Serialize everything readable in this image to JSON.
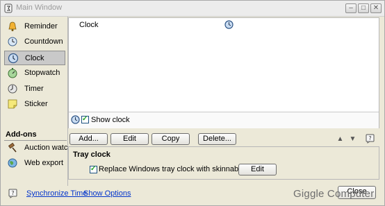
{
  "window": {
    "title": "Main Window"
  },
  "sidebar": {
    "items": [
      {
        "label": "Reminder",
        "icon": "bell-icon"
      },
      {
        "label": "Countdown",
        "icon": "countdown-icon"
      },
      {
        "label": "Clock",
        "icon": "clock-icon",
        "selected": true
      },
      {
        "label": "Stopwatch",
        "icon": "stopwatch-icon"
      },
      {
        "label": "Timer",
        "icon": "timer-icon"
      },
      {
        "label": "Sticker",
        "icon": "sticker-icon"
      }
    ],
    "addons_heading": "Add-ons",
    "addons": [
      {
        "label": "Auction watch",
        "icon": "auction-icon"
      },
      {
        "label": "Web export",
        "icon": "globe-icon"
      }
    ]
  },
  "main": {
    "list_item": "Clock",
    "show_clock_label": "Show clock",
    "buttons": {
      "add": "Add...",
      "edit": "Edit",
      "copy": "Copy",
      "delete": "Delete..."
    },
    "tray": {
      "heading": "Tray clock",
      "replace_label": "Replace Windows tray clock with skinnable clock",
      "edit": "Edit"
    }
  },
  "footer": {
    "sync_label": "Synchronize Time",
    "options_label": "Show Options",
    "close_label": "Close",
    "watermark": "Giggle Computer"
  },
  "colors": {
    "link": "#0033cc",
    "selected_bg": "#c9c9c9",
    "panel_bg": "#ece9d8"
  }
}
